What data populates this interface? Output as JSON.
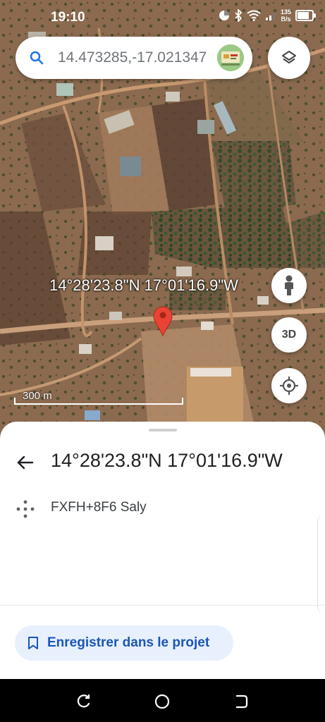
{
  "status_bar": {
    "time": "19:10",
    "net_rate_value": "135",
    "net_rate_unit": "B/s"
  },
  "search": {
    "query": "14.473285,-17.021347",
    "icon": "search-icon"
  },
  "map": {
    "coordinate_label": "14°28'23.8\"N 17°01'16.9\"W",
    "scale_label": "300 m",
    "buttons": {
      "street_view": "pegman-icon",
      "three_d": "3D",
      "my_location": "my-location-icon",
      "layers": "layers-icon"
    },
    "pin_color": "#ea4335"
  },
  "place_sheet": {
    "title": "14°28'23.8\"N 17°01'16.9\"W",
    "plus_code": "FXFH+8F6 Saly",
    "save_button": "Enregistrer dans le projet"
  },
  "colors": {
    "accent": "#1a56b8",
    "save_button_bg": "#e8f0fe",
    "search_icon": "#1a73e8"
  }
}
